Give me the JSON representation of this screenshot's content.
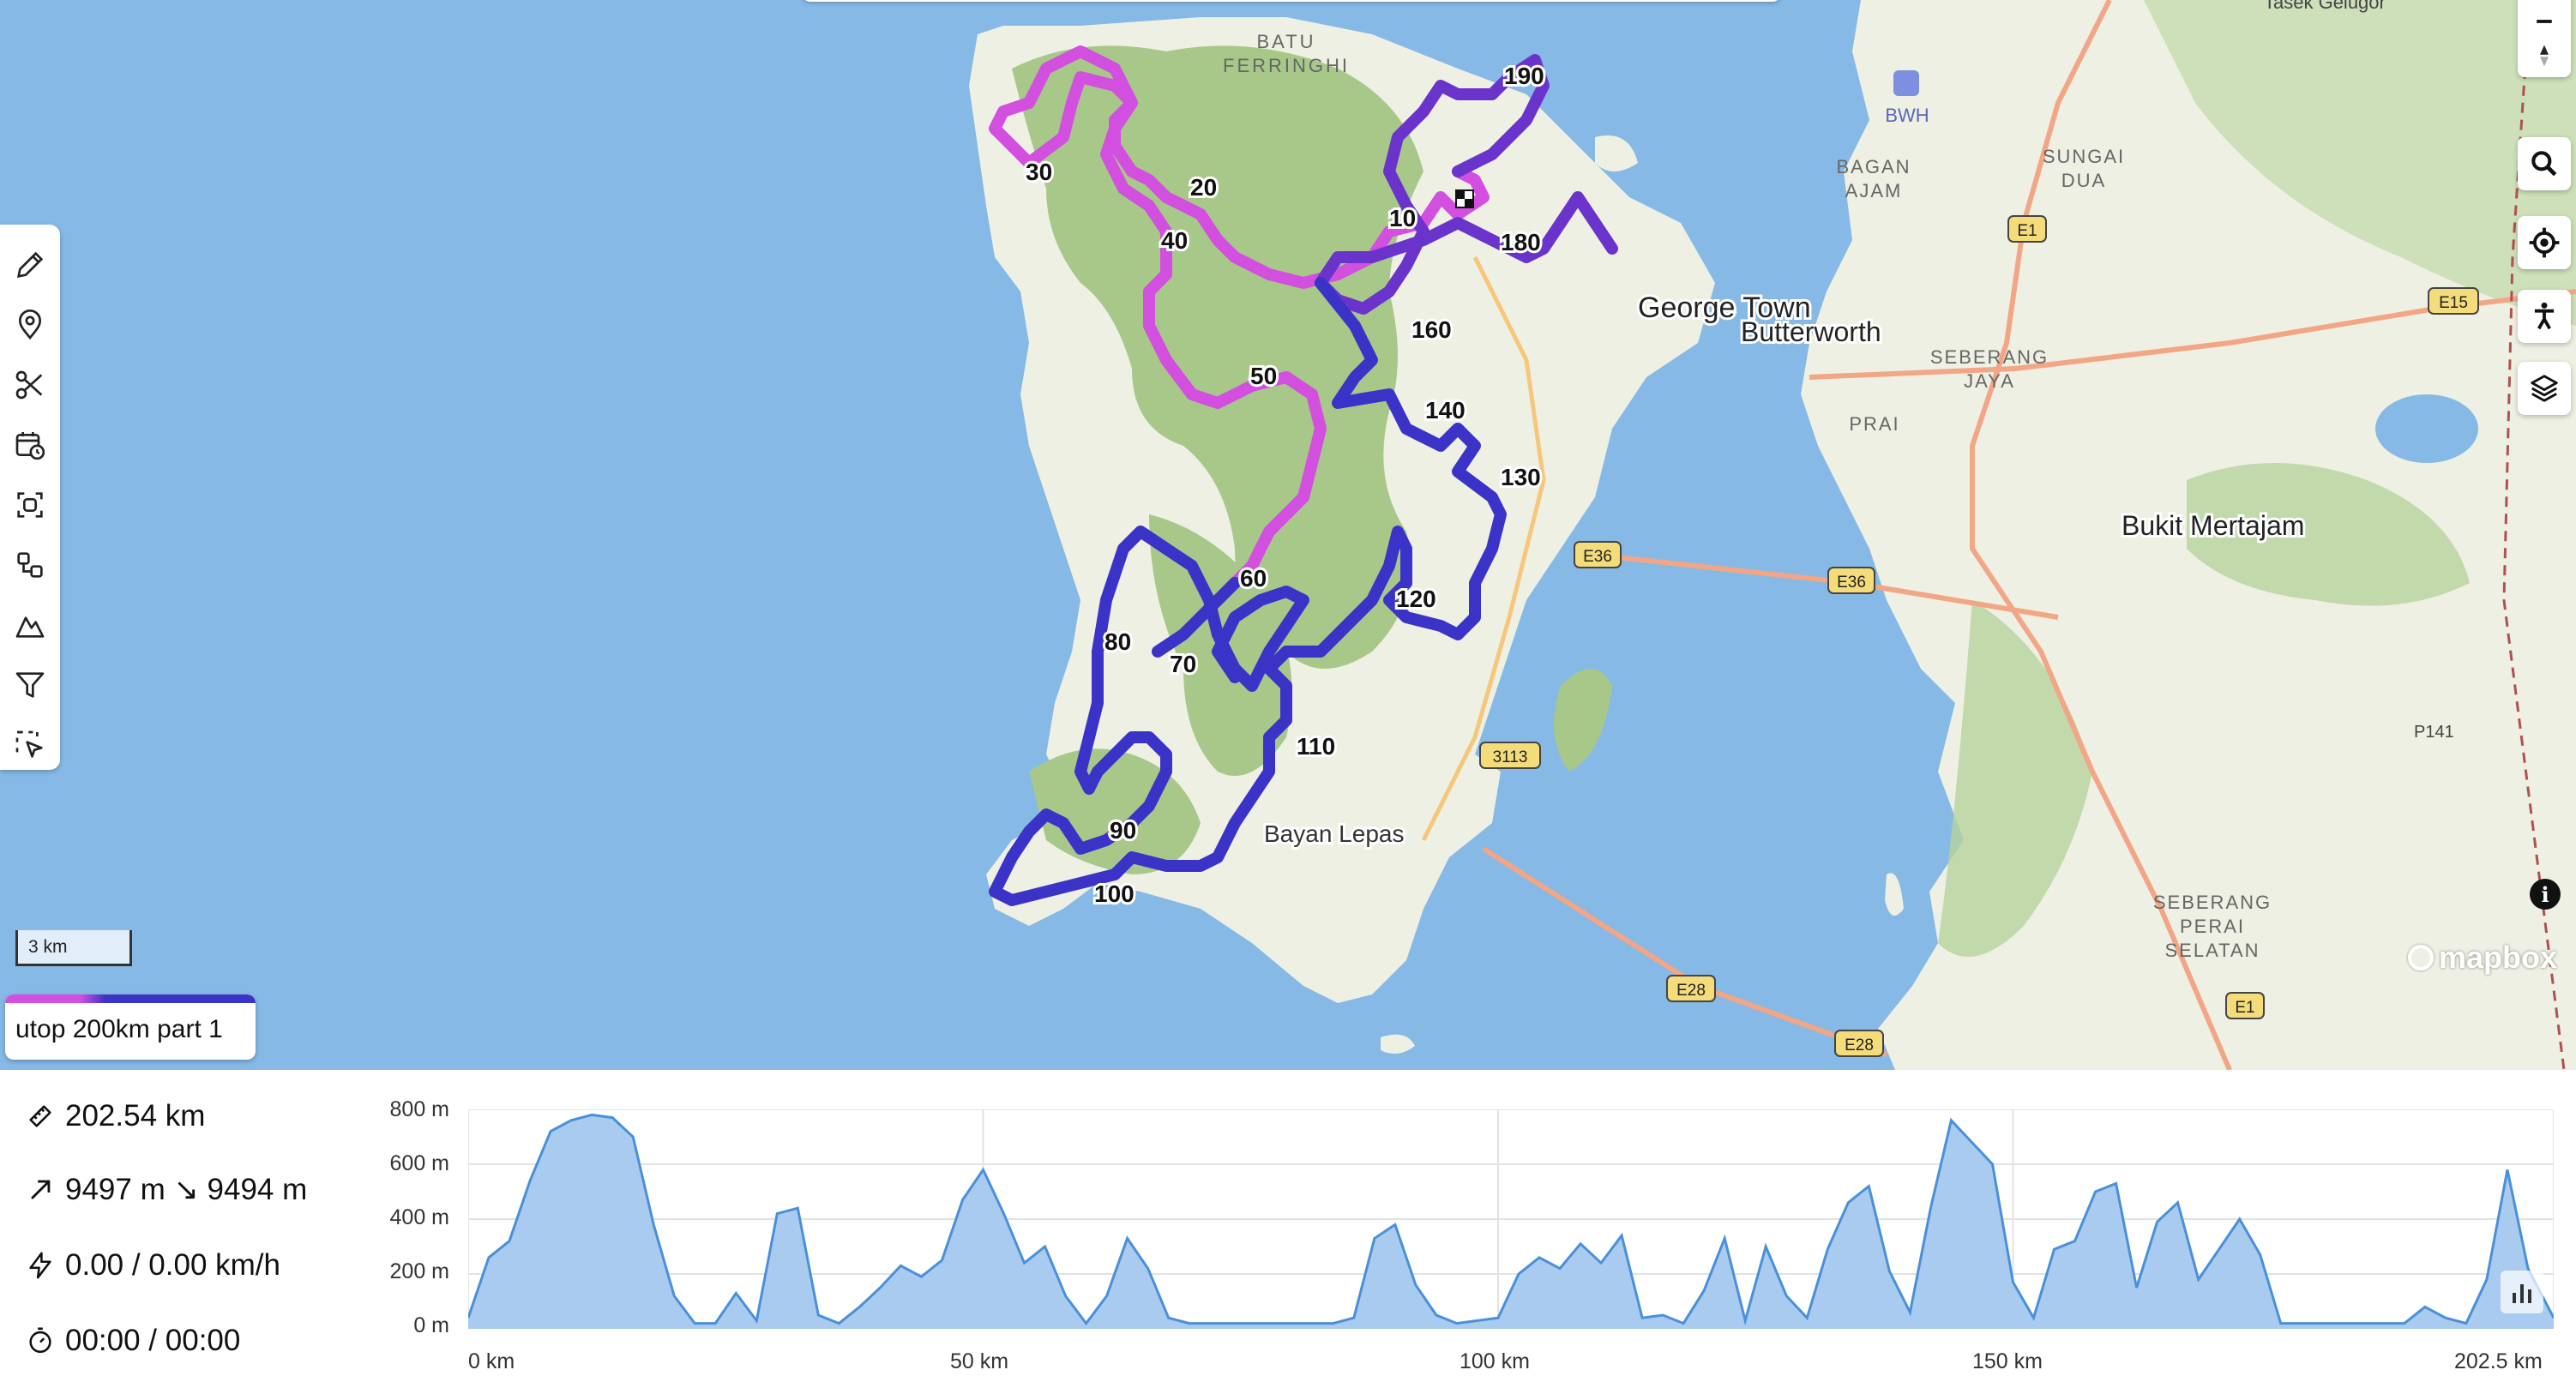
{
  "map": {
    "place_labels": {
      "batu_ferringhi_1": "BATU",
      "batu_ferringhi_2": "FERRINGHI",
      "george_town": "George Town",
      "butterworth": "Butterworth",
      "bayan_lepas": "Bayan Lepas",
      "bukit_mertajam": "Bukit Mertajam",
      "bagan_ajam_1": "BAGAN",
      "bagan_ajam_2": "AJAM",
      "sungai_dua_1": "SUNGAI",
      "sungai_dua_2": "DUA",
      "seberang_jaya_1": "SEBERANG",
      "seberang_jaya_2": "JAYA",
      "prai": "PRAI",
      "seberang_perai_1": "SEBERANG",
      "seberang_perai_2": "PERAI",
      "seberang_perai_3": "SELATAN",
      "bwh": "BWH",
      "tasek_gelugor": "Tasek Gelugor",
      "p141": "P141"
    },
    "road_shields": {
      "e36a": "E36",
      "e36b": "E36",
      "e1a": "E1",
      "e1b": "E1",
      "e15": "E15",
      "e28a": "E28",
      "e28b": "E28",
      "r3113": "3113"
    },
    "distance_markers": [
      "10",
      "20",
      "30",
      "40",
      "50",
      "60",
      "70",
      "80",
      "90",
      "100",
      "110",
      "120",
      "130",
      "140",
      "160",
      "180",
      "190"
    ],
    "scale_label": "3 km",
    "attribution": "mapbox",
    "colors": {
      "water": "#86b9e6",
      "land": "#eef0e4",
      "hills": "#a8c88a",
      "route_start": "#d24fe0",
      "route_end": "#3b33c8"
    }
  },
  "track": {
    "name": "utop 200km part 1"
  },
  "stats": {
    "distance": "202.54 km",
    "elevation": "9497 m  ↘ 9494 m",
    "speed": "0.00 / 0.00 km/h",
    "time": "00:00 / 00:00"
  },
  "elevation_profile": {
    "y_ticks": [
      "800 m",
      "600 m",
      "400 m",
      "200 m",
      "0 m"
    ],
    "x_ticks": [
      "0 km",
      "50 km",
      "100 km",
      "150 km",
      "202.5 km"
    ],
    "chart_data": {
      "type": "area",
      "x": [
        0,
        2,
        4,
        6,
        8,
        10,
        12,
        14,
        16,
        18,
        20,
        22,
        24,
        26,
        28,
        30,
        32,
        34,
        36,
        38,
        40,
        42,
        44,
        46,
        48,
        50,
        52,
        54,
        56,
        58,
        60,
        62,
        64,
        66,
        68,
        70,
        72,
        74,
        76,
        78,
        80,
        82,
        84,
        86,
        88,
        90,
        92,
        94,
        96,
        98,
        100,
        102,
        104,
        106,
        108,
        110,
        112,
        114,
        116,
        118,
        120,
        122,
        124,
        126,
        128,
        130,
        132,
        134,
        136,
        138,
        140,
        142,
        144,
        146,
        148,
        150,
        152,
        154,
        156,
        158,
        160,
        162,
        164,
        166,
        168,
        170,
        172,
        174,
        176,
        178,
        180,
        182,
        184,
        186,
        188,
        190,
        192,
        194,
        196,
        198,
        200,
        202.5
      ],
      "y": [
        40,
        260,
        320,
        540,
        720,
        760,
        780,
        770,
        700,
        380,
        120,
        20,
        20,
        130,
        30,
        420,
        440,
        50,
        20,
        80,
        150,
        230,
        190,
        250,
        470,
        580,
        420,
        240,
        300,
        120,
        20,
        120,
        330,
        220,
        40,
        20,
        20,
        20,
        20,
        20,
        20,
        20,
        20,
        40,
        330,
        380,
        160,
        50,
        20,
        30,
        40,
        200,
        260,
        220,
        310,
        240,
        340,
        40,
        50,
        20,
        140,
        330,
        30,
        300,
        120,
        40,
        290,
        460,
        520,
        210,
        60,
        440,
        760,
        680,
        600,
        170,
        40,
        290,
        320,
        500,
        530,
        150,
        390,
        460,
        180,
        290,
        400,
        270,
        20,
        20,
        20,
        20,
        20,
        20,
        20,
        80,
        40,
        20,
        180,
        580,
        220,
        40
      ],
      "ylim": [
        0,
        800
      ],
      "xlim": [
        0,
        202.5
      ],
      "color": "#4a90d9",
      "fill": "#a9cbef"
    }
  }
}
